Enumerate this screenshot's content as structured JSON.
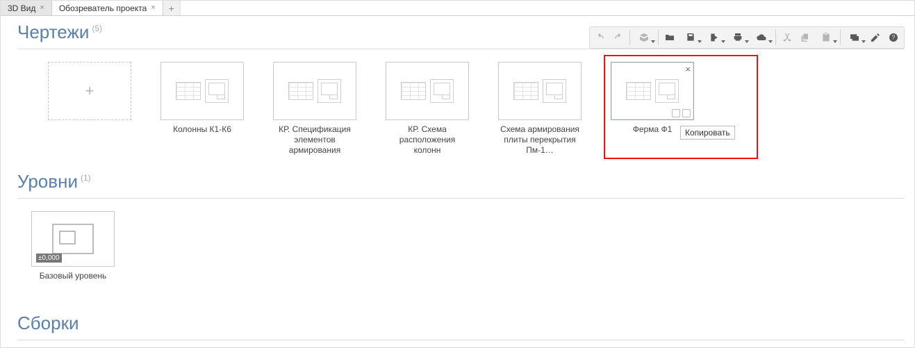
{
  "tabs": [
    {
      "label": "3D Вид",
      "active": false
    },
    {
      "label": "Обозреватель проекта",
      "active": true
    }
  ],
  "sections": {
    "drawings": {
      "title": "Чертежи",
      "count": "(5)"
    },
    "levels": {
      "title": "Уровни",
      "count": "(1)"
    },
    "assemblies": {
      "title": "Сборки"
    }
  },
  "drawings": [
    {
      "label": "Колонны К1-К6"
    },
    {
      "label": "КР. Спецификация элементов армирования"
    },
    {
      "label": "КР. Схема расположения колонн"
    },
    {
      "label": "Схема армирования плиты перекрытия Пм-1…"
    },
    {
      "label": "Ферма Ф1",
      "selected": true
    }
  ],
  "levels": [
    {
      "label": "Базовый уровень",
      "tag": "±0,000"
    }
  ],
  "tooltip": "Копировать",
  "icons": {
    "add": "+",
    "close": "×"
  }
}
